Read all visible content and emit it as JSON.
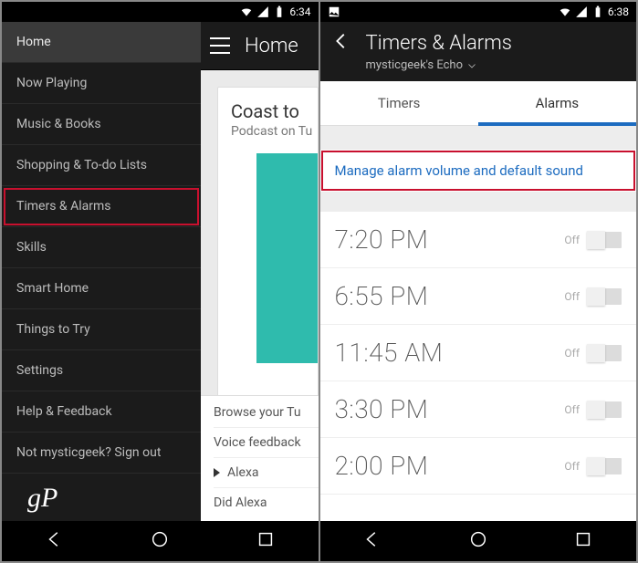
{
  "left": {
    "status_time": "6:34",
    "sidebar": {
      "items": [
        {
          "label": "Home",
          "active": true
        },
        {
          "label": "Now Playing"
        },
        {
          "label": "Music & Books"
        },
        {
          "label": "Shopping & To-do Lists"
        },
        {
          "label": "Timers & Alarms",
          "highlighted": true
        },
        {
          "label": "Skills"
        },
        {
          "label": "Smart Home"
        },
        {
          "label": "Things to Try"
        },
        {
          "label": "Settings"
        },
        {
          "label": "Help & Feedback"
        },
        {
          "label": "Not mysticgeek? Sign out"
        }
      ]
    },
    "peek": {
      "header_title": "Home",
      "card_title": "Coast to",
      "card_sub": "Podcast on Tu",
      "footer_browse": "Browse your Tu",
      "footer_voice": "Voice feedback",
      "footer_alexa": "Alexa",
      "footer_did": "Did Alexa"
    },
    "logo": "gP"
  },
  "right": {
    "status_time": "6:38",
    "title": "Timers & Alarms",
    "subtitle": "mysticgeek's Echo",
    "tabs": {
      "timers": "Timers",
      "alarms": "Alarms"
    },
    "manage_label": "Manage alarm volume and default sound",
    "alarms": [
      {
        "time": "7:20 PM",
        "state": "Off"
      },
      {
        "time": "6:55 PM",
        "state": "Off"
      },
      {
        "time": "11:45 AM",
        "state": "Off"
      },
      {
        "time": "3:30 PM",
        "state": "Off"
      },
      {
        "time": "2:00 PM",
        "state": "Off"
      }
    ]
  }
}
